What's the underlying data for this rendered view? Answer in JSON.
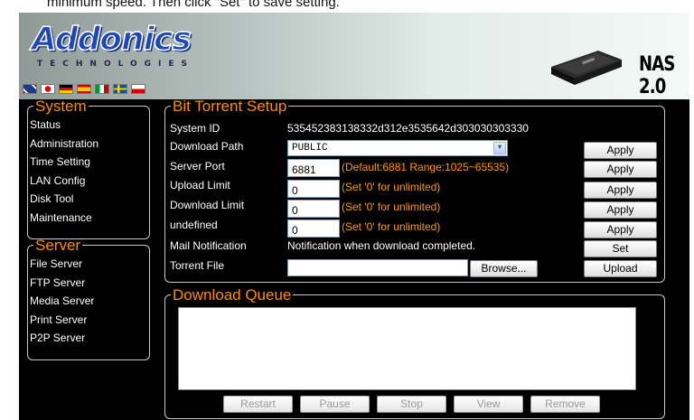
{
  "instruction_text": "minimum speed. Then click \"Set\" to save setting.",
  "brand": {
    "logo": "Addonics",
    "tagline": "TECHNOLOGIES",
    "product": "NAS 2.0"
  },
  "flags": [
    "uk-flag",
    "japan-flag",
    "germany-flag",
    "spain-flag",
    "italy-flag",
    "sweden-flag",
    "poland-flag"
  ],
  "sidebar": {
    "system": {
      "title": "System",
      "items": [
        "Status",
        "Administration",
        "Time Setting",
        "LAN Config",
        "Disk Tool",
        "Maintenance"
      ]
    },
    "server": {
      "title": "Server",
      "items": [
        "File Server",
        "FTP Server",
        "Media Server",
        "Print Server",
        "P2P Server"
      ]
    }
  },
  "bt": {
    "title": "Bit Torrent Setup",
    "system_id_label": "System ID",
    "system_id_value": "535452383138332d312e3535642d303030303330",
    "download_path_label": "Download Path",
    "download_path_value": "PUBLIC",
    "server_port_label": "Server Port",
    "server_port_value": "6881",
    "server_port_hint": "(Default:6881 Range:1025~65535)",
    "upload_limit_label": "Upload Limit",
    "upload_limit_value": "0",
    "upload_limit_hint": "(Set '0' for unlimited)",
    "download_limit_label": "Download Limit",
    "download_limit_value": "0",
    "download_limit_hint": "(Set '0' for unlimited)",
    "undefined_label": "undefined",
    "undefined_value": "0",
    "undefined_hint": "(Set '0' for unlimited)",
    "mail_label": "Mail Notification",
    "mail_value": "Notification when download completed.",
    "torrent_label": "Torrent File",
    "torrent_value": "",
    "browse_label": "Browse...",
    "apply_label": "Apply",
    "set_label": "Set",
    "upload_label": "Upload"
  },
  "queue": {
    "title": "Download Queue",
    "buttons": {
      "restart": "Restart",
      "pause": "Pause",
      "stop": "Stop",
      "view": "View",
      "remove": "Remove"
    }
  },
  "colors": {
    "accent": "#ff8c00",
    "hint": "#ff9900",
    "panel_bg": "#000000",
    "logo_blue": "#1f47b5"
  }
}
